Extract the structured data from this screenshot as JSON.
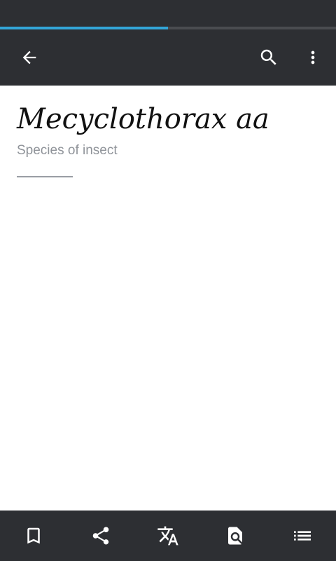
{
  "browser": {
    "load_progress_percent": 50,
    "progress_color": "#33a6d8"
  },
  "toolbar": {
    "back_icon": "arrow-back-icon",
    "search_icon": "search-icon",
    "more_icon": "more-vert-icon",
    "background": "#2d2f33"
  },
  "article": {
    "title": "Mecyclothorax aa",
    "description": "Species of insect"
  },
  "bottom_bar": {
    "items": [
      {
        "icon": "bookmark-icon"
      },
      {
        "icon": "share-icon"
      },
      {
        "icon": "translate-icon"
      },
      {
        "icon": "find-in-page-icon"
      },
      {
        "icon": "table-of-contents-icon"
      }
    ]
  }
}
